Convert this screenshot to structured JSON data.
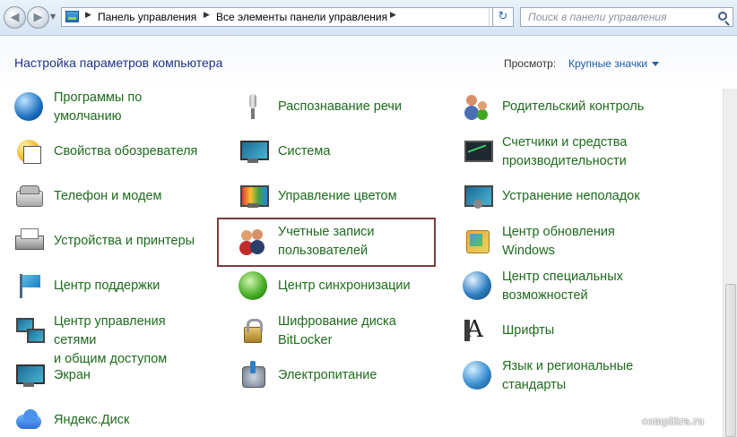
{
  "navbar": {
    "breadcrumbs": [
      "Панель управления",
      "Все элементы панели управления"
    ],
    "search_placeholder": "Поиск в панели управления"
  },
  "header": {
    "title": "Настройка параметров компьютера",
    "view_label": "Просмотр:",
    "view_value": "Крупные значки"
  },
  "items": [
    {
      "label": "Программы по\nумолчанию",
      "icon": "default-programs-icon"
    },
    {
      "label": "Свойства обозревателя",
      "icon": "internet-options-icon"
    },
    {
      "label": "Телефон и модем",
      "icon": "phone-modem-icon"
    },
    {
      "label": "Устройства и принтеры",
      "icon": "printer-icon"
    },
    {
      "label": "Центр поддержки",
      "icon": "action-center-flag-icon"
    },
    {
      "label": "Центр управления сетями\nи общим доступом",
      "icon": "network-icon"
    },
    {
      "label": "Экран",
      "icon": "display-icon"
    },
    {
      "label": "Яндекс.Диск",
      "icon": "cloud-icon"
    },
    {
      "label": "Распознавание речи",
      "icon": "microphone-icon"
    },
    {
      "label": "Система",
      "icon": "system-icon"
    },
    {
      "label": "Управление цветом",
      "icon": "color-management-icon"
    },
    {
      "label": "Учетные записи\nпользователей",
      "icon": "user-accounts-icon"
    },
    {
      "label": "Центр синхронизации",
      "icon": "sync-icon"
    },
    {
      "label": "Шифрование диска\nBitLocker",
      "icon": "bitlocker-lock-icon"
    },
    {
      "label": "Электропитание",
      "icon": "power-icon"
    },
    {
      "label": "Родительский контроль",
      "icon": "parental-controls-icon"
    },
    {
      "label": "Счетчики и средства\nпроизводительности",
      "icon": "performance-icon"
    },
    {
      "label": "Устранение неполадок",
      "icon": "troubleshooting-icon"
    },
    {
      "label": "Центр обновления\nWindows",
      "icon": "windows-update-icon"
    },
    {
      "label": "Центр специальных\nвозможностей",
      "icon": "accessibility-icon"
    },
    {
      "label": "Шрифты",
      "icon": "fonts-icon"
    },
    {
      "label": "Язык и региональные\nстандарты",
      "icon": "region-language-icon"
    }
  ],
  "watermark": "complitra.ru"
}
